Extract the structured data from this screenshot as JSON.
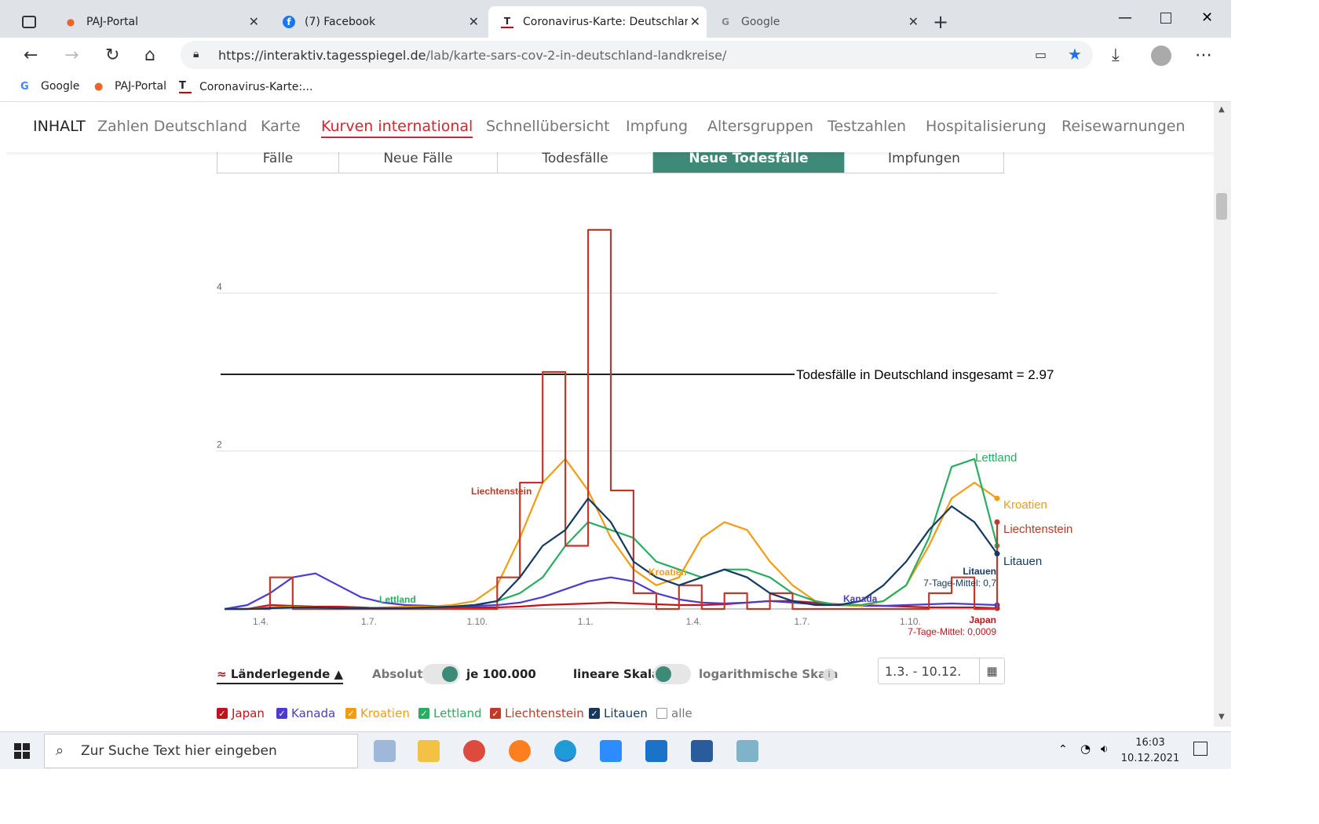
{
  "browser": {
    "tabs": [
      {
        "label": "PAJ-Portal",
        "active": false
      },
      {
        "label": "(7) Facebook",
        "active": false
      },
      {
        "label": "Coronavirus-Karte: Deutschland",
        "active": true
      },
      {
        "label": "Google",
        "active": false
      }
    ],
    "url_domain": "https://interaktiv.tagesspiegel.de",
    "url_path": "/lab/karte-sars-cov-2-in-deutschland-landkreise/",
    "bookmarks": [
      "Google",
      "PAJ-Portal",
      "Coronavirus-Karte:..."
    ]
  },
  "nav": {
    "inhalt": "INHALT",
    "items": [
      "Zahlen Deutschland",
      "Karte",
      "Kurven international",
      "Schnellübersicht",
      "Impfung",
      "Altersgruppen",
      "Testzahlen",
      "Hospitalisierung",
      "Reisewarnungen"
    ],
    "active": "Kurven international"
  },
  "segments": [
    "Fälle",
    "Neue Fälle",
    "Todesfälle",
    "Neue Todesfälle",
    "Impfungen"
  ],
  "chart_data": {
    "type": "line",
    "x_ticks": [
      "1.4.",
      "1.7.",
      "1.10.",
      "1.1.",
      "1.4.",
      "1.7.",
      "1.10."
    ],
    "y_ticks": [
      2,
      4
    ],
    "ylim": [
      0,
      5
    ],
    "reference_line": {
      "label": "Todesfälle in Deutschland insgesamt = 2.97",
      "value": 3.0
    },
    "series": [
      {
        "name": "Japan",
        "color": "#c0141c",
        "values": [
          0,
          0,
          0.05,
          0.04,
          0.03,
          0.03,
          0.02,
          0.01,
          0.01,
          0.01,
          0.02,
          0.02,
          0.02,
          0.03,
          0.05,
          0.06,
          0.07,
          0.08,
          0.07,
          0.06,
          0.05,
          0.05,
          0.06,
          0.08,
          0.1,
          0.1,
          0.08,
          0.06,
          0.05,
          0.04,
          0.03,
          0.02,
          0.02,
          0.02,
          0.01
        ]
      },
      {
        "name": "Kanada",
        "color": "#4c3bd1",
        "values": [
          0,
          0.05,
          0.2,
          0.4,
          0.45,
          0.3,
          0.15,
          0.08,
          0.05,
          0.04,
          0.03,
          0.04,
          0.05,
          0.08,
          0.15,
          0.25,
          0.35,
          0.4,
          0.35,
          0.2,
          0.12,
          0.08,
          0.07,
          0.08,
          0.1,
          0.08,
          0.06,
          0.05,
          0.04,
          0.04,
          0.05,
          0.06,
          0.07,
          0.06,
          0.05
        ]
      },
      {
        "name": "Kroatien",
        "color": "#f39c12",
        "values": [
          0,
          0,
          0.02,
          0.03,
          0.02,
          0.01,
          0.01,
          0.02,
          0.03,
          0.03,
          0.05,
          0.1,
          0.3,
          0.9,
          1.6,
          1.9,
          1.5,
          0.9,
          0.5,
          0.3,
          0.4,
          0.9,
          1.1,
          1.0,
          0.6,
          0.3,
          0.1,
          0.05,
          0.04,
          0.1,
          0.3,
          0.8,
          1.4,
          1.6,
          1.4
        ]
      },
      {
        "name": "Lettland",
        "color": "#27ae60",
        "values": [
          0,
          0,
          0.01,
          0.02,
          0.02,
          0.01,
          0.01,
          0.01,
          0.01,
          0.02,
          0.03,
          0.05,
          0.1,
          0.2,
          0.4,
          0.8,
          1.1,
          1.0,
          0.9,
          0.6,
          0.5,
          0.4,
          0.5,
          0.5,
          0.4,
          0.2,
          0.1,
          0.05,
          0.05,
          0.1,
          0.3,
          0.9,
          1.8,
          1.9,
          0.8
        ]
      },
      {
        "name": "Liechtenstein",
        "color": "#c0392b",
        "values": [
          0,
          0,
          0.4,
          0,
          0,
          0,
          0,
          0,
          0,
          0,
          0,
          0,
          0.4,
          1.6,
          3.0,
          0.8,
          4.8,
          1.5,
          0.2,
          0,
          0.3,
          0,
          0.2,
          0,
          0.2,
          0,
          0,
          0,
          0,
          0,
          0,
          0.2,
          0.4,
          0,
          1.1
        ]
      },
      {
        "name": "Litauen",
        "color": "#153a5e",
        "values": [
          0,
          0,
          0.01,
          0.02,
          0.02,
          0.01,
          0.01,
          0.01,
          0.01,
          0.02,
          0.03,
          0.05,
          0.1,
          0.4,
          0.8,
          1.0,
          1.4,
          1.1,
          0.6,
          0.4,
          0.3,
          0.4,
          0.5,
          0.4,
          0.2,
          0.1,
          0.05,
          0.05,
          0.1,
          0.3,
          0.6,
          1.0,
          1.3,
          1.1,
          0.7
        ]
      }
    ],
    "annotations": {
      "Lettland_mid": "Lettland",
      "Liechtenstein_mid": "Liechtenstein",
      "Kroatien_mid": "Kroatien",
      "Kanada_mid": "Kanada",
      "Litauen_end": "Litauen",
      "Litauen_mean": "7-Tage-Mittel: 0,7",
      "Japan_end": "Japan",
      "Japan_mean": "7-Tage-Mittel: 0,0009"
    }
  },
  "controls": {
    "legend_label": "Länderlegende ▲",
    "absolut": "Absolut",
    "je100000": "je 100.000",
    "linear": "lineare Skala",
    "log": "logarithmische Skala",
    "info": "i",
    "date_range": "1.3. - 10.12.",
    "checkboxes": [
      "Japan",
      "Kanada",
      "Kroatien",
      "Lettland",
      "Liechtenstein",
      "Litauen",
      "alle"
    ]
  },
  "taskbar": {
    "search_placeholder": "Zur Suche Text hier eingeben",
    "time": "16:03",
    "date": "10.12.2021"
  }
}
